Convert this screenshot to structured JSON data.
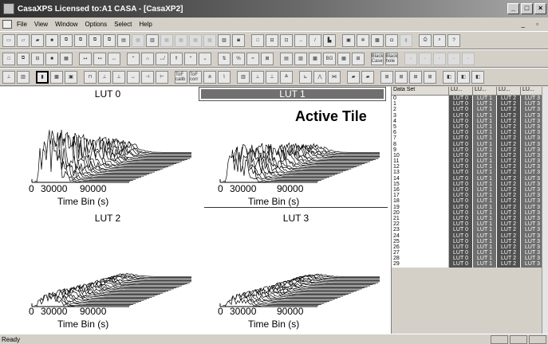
{
  "window": {
    "title": "CasaXPS Licensed to:A1 CASA - [CasaXP2]"
  },
  "menu": [
    "File",
    "View",
    "Window",
    "Options",
    "Select",
    "Help"
  ],
  "toolbar_labels": {
    "bg": "BG",
    "black_case": "Black Case",
    "black_hole": "Black hole",
    "tof_calib": "ToF calib",
    "tof_corr": "ToF corr"
  },
  "tiles": [
    {
      "title": "LUT 0",
      "active": false
    },
    {
      "title": "LUT 1",
      "active": true
    },
    {
      "title": "LUT 2",
      "active": false
    },
    {
      "title": "LUT 3",
      "active": false
    }
  ],
  "active_tile_label": "Active Tile",
  "axis": {
    "ticks": [
      "0",
      "30000",
      "90000"
    ],
    "xlabel": "Time Bin (s)"
  },
  "data_panel": {
    "headers": [
      "Data Set",
      "LU...",
      "LU...",
      "LU...",
      "LU..."
    ],
    "rows": [
      "0",
      "1",
      "2",
      "3",
      "4",
      "5",
      "6",
      "7",
      "8",
      "9",
      "10",
      "11",
      "12",
      "13",
      "14",
      "15",
      "16",
      "17",
      "18",
      "19",
      "20",
      "21",
      "22",
      "23",
      "24",
      "25",
      "26",
      "27",
      "28",
      "29"
    ],
    "lut_cells": [
      "LUT 0",
      "LUT 1",
      "LUT 2",
      "LUT 3"
    ]
  },
  "status": {
    "text": "Ready"
  }
}
